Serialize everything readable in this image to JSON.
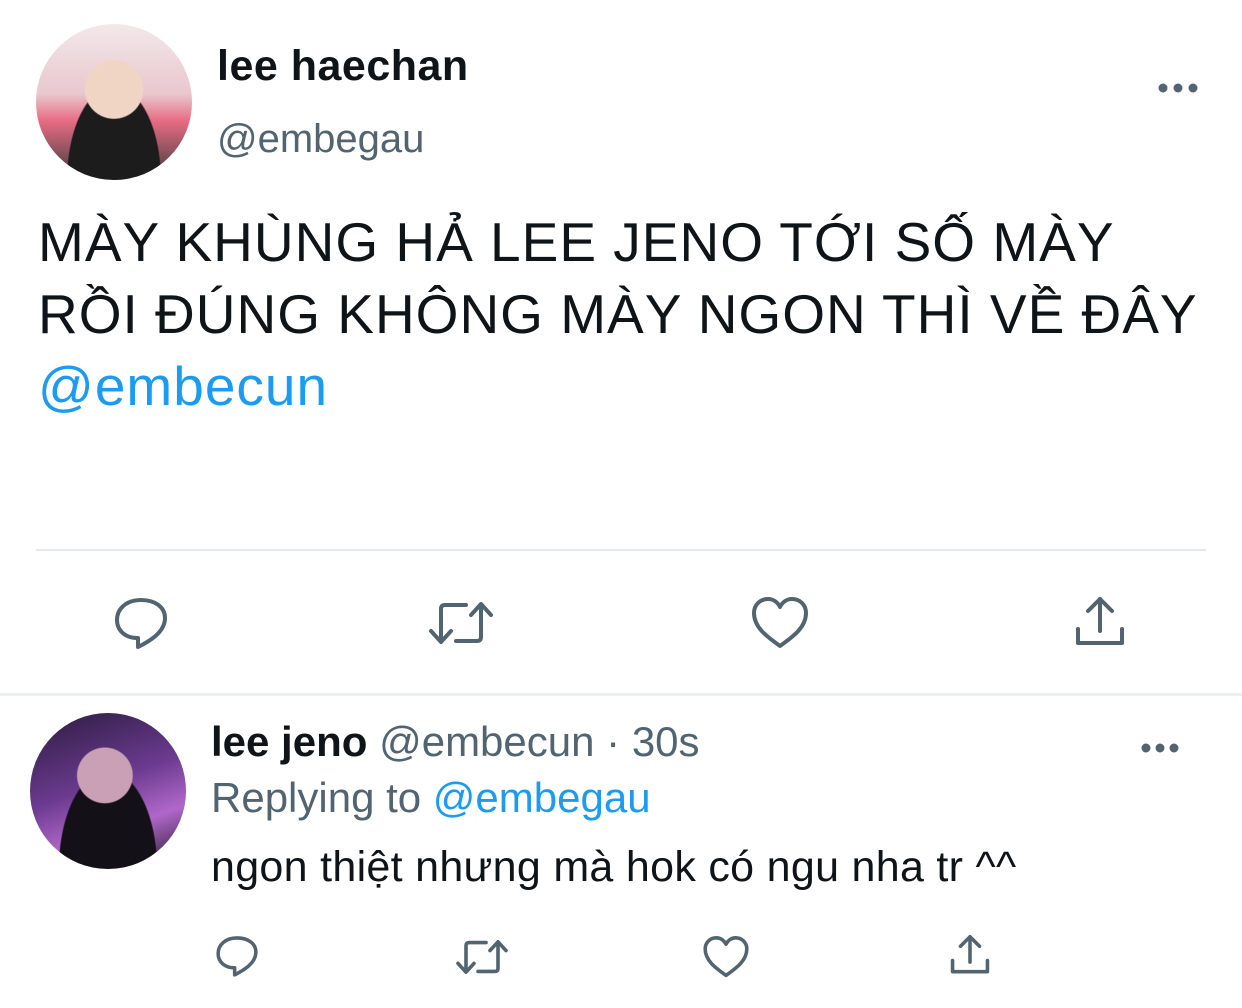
{
  "tweet": {
    "author_name": "lee haechan",
    "author_handle": "@embegau",
    "more_icon": "more-horizontal-icon",
    "text": "MÀY KHÙNG HẢ LEE JENO TỚI SỐ MÀY RỒI ĐÚNG KHÔNG MÀY NGON THÌ VỀ ĐÂY ",
    "mention": "@embecun",
    "actions": [
      "reply-icon",
      "retweet-icon",
      "like-icon",
      "share-icon"
    ]
  },
  "reply": {
    "author_name": "lee jeno",
    "author_handle": "@embecun",
    "separator": " · ",
    "time": "30s",
    "replying_prefix": "Replying to ",
    "replying_to": "@embegau",
    "text": "ngon thiệt nhưng mà hok có ngu nha tr ^^",
    "actions": [
      "reply-icon",
      "retweet-icon",
      "like-icon",
      "share-icon"
    ]
  },
  "colors": {
    "text": "#0f1419",
    "secondary": "#536471",
    "link": "#1d9bf0",
    "divider": "#e6e9eb"
  }
}
